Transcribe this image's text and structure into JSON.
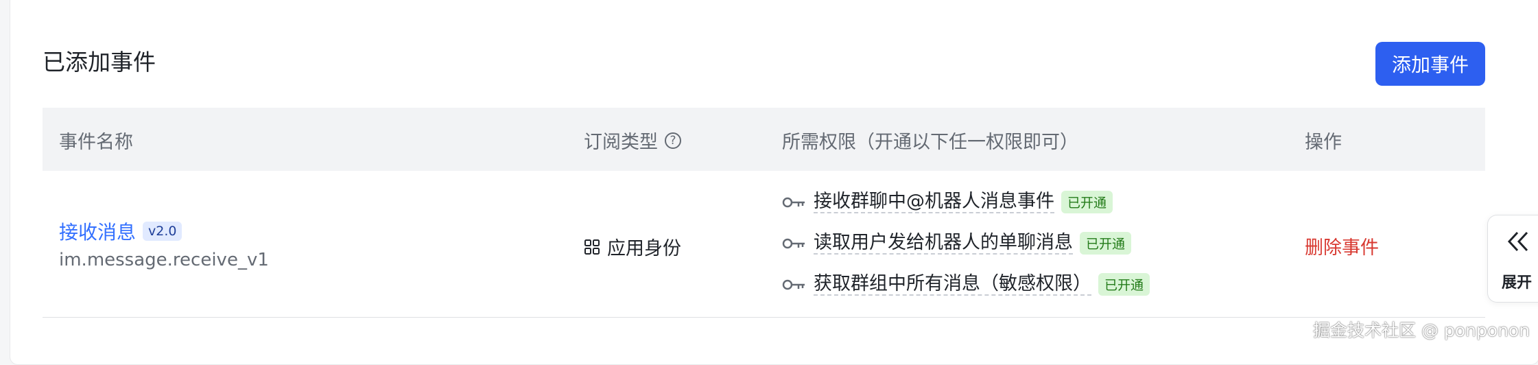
{
  "section": {
    "title": "已添加事件",
    "add_button_label": "添加事件"
  },
  "table": {
    "headers": {
      "event_name": "事件名称",
      "subscription_type": "订阅类型",
      "permissions": "所需权限（开通以下任一权限即可）",
      "actions": "操作"
    },
    "rows": [
      {
        "event_name": "接收消息",
        "version": "v2.0",
        "event_key": "im.message.receive_v1",
        "subscription_type": "应用身份",
        "permissions": [
          {
            "label": "接收群聊中@机器人消息事件",
            "status": "已开通"
          },
          {
            "label": "读取用户发给机器人的单聊消息",
            "status": "已开通"
          },
          {
            "label": "获取群组中所有消息（敏感权限）",
            "status": "已开通"
          }
        ],
        "action_label": "删除事件"
      }
    ]
  },
  "expand_panel": {
    "label": "展开"
  },
  "watermark": "掘金技术社区 @ ponponon",
  "colors": {
    "accent": "#2d5ff0",
    "link": "#3370ff",
    "danger": "#d83931",
    "success_bg": "#d9f5d6",
    "success_text": "#237b19"
  },
  "icons": {
    "help": "question-circle-icon",
    "grid": "grid-icon",
    "key": "key-icon",
    "expand": "double-chevron-left-icon"
  }
}
